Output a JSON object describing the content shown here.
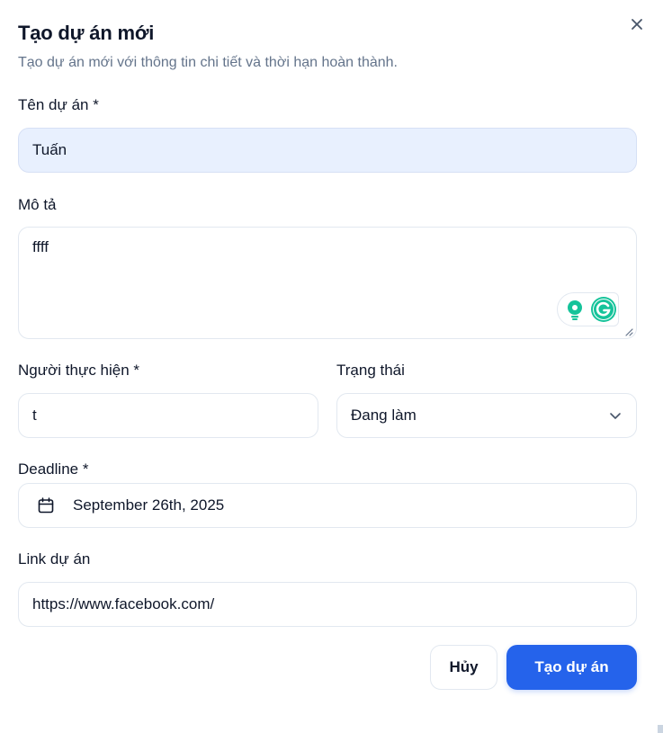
{
  "dialog": {
    "title": "Tạo dự án mới",
    "subtitle": "Tạo dự án mới với thông tin chi tiết và thời hạn hoàn thành.",
    "close_icon": "close-icon"
  },
  "fields": {
    "name": {
      "label": "Tên dự án *",
      "value": "Tuấn"
    },
    "description": {
      "label": "Mô tả",
      "value": "ffff"
    },
    "assignee": {
      "label": "Người thực hiện *",
      "value": "t"
    },
    "status": {
      "label": "Trạng thái",
      "value": "Đang làm",
      "icon": "chevron-down-icon"
    },
    "deadline": {
      "label": "Deadline *",
      "value": "September 26th, 2025",
      "icon": "calendar-icon"
    },
    "link": {
      "label": "Link dự án",
      "value": "https://www.facebook.com/"
    }
  },
  "extension": {
    "icons": [
      "lightbulb-icon",
      "grammarly-icon"
    ]
  },
  "actions": {
    "cancel_label": "Hủy",
    "submit_label": "Tạo dự án"
  },
  "colors": {
    "primary": "#2563eb",
    "autofill_bg": "#e8f0fe",
    "grammarly_green": "#15c39a",
    "border": "#e2e8f0",
    "muted_text": "#64748b"
  }
}
